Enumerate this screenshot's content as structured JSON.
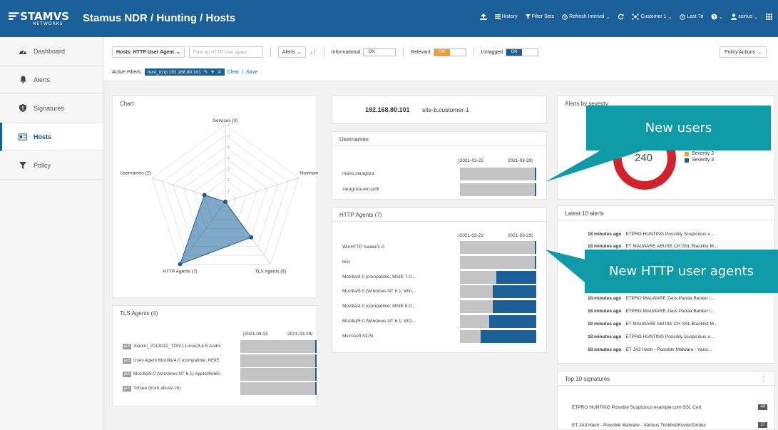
{
  "brand": {
    "logo_main": "STAMVS",
    "logo_sub": "NETWORKS"
  },
  "header": {
    "title": "Stamus NDR / Hunting / Hosts",
    "nav": {
      "history": "History",
      "filter_sets": "Filter Sets",
      "refresh": "Refresh Interval",
      "tenant": "Customer 1",
      "period": "Last 7d",
      "user": "scirius"
    }
  },
  "sidebar": {
    "items": [
      {
        "label": "Dashboard",
        "icon": "dashboard-icon"
      },
      {
        "label": "Alerts",
        "icon": "bell-icon"
      },
      {
        "label": "Signatures",
        "icon": "shield-icon"
      },
      {
        "label": "Hosts",
        "icon": "id-card-icon"
      },
      {
        "label": "Policy",
        "icon": "filter-icon"
      }
    ]
  },
  "filters": {
    "type_select": "Hosts: HTTP User Agent",
    "filter_placeholder": "Filter by HTTP User Agent",
    "sort_select": "Alerts",
    "informational_label": "Informational",
    "informational_on": "ON",
    "relevant_label": "Relevant",
    "relevant_on": "ON",
    "untagged_label": "Untagged",
    "untagged_on": "ON",
    "policy_actions": "Policy Actions",
    "active_filters_label": "Active Filters:",
    "active_chip": "host_id.ip:192.168.80.101",
    "clear": "Clear",
    "save": "Save"
  },
  "chart_panel": {
    "title": "Chart",
    "chart_data": {
      "type": "radar",
      "axes": [
        "Services (0)",
        "Hostnames (",
        "TLS Agents (4)",
        "HTTP Agents (7)",
        "Usernames (2)"
      ],
      "values": [
        0,
        0,
        4,
        7,
        2
      ],
      "ticks": [
        "1",
        "2",
        "3",
        "4",
        "5",
        "6",
        "7"
      ],
      "rmax": 7
    }
  },
  "host": {
    "ip": "192.168.80.101",
    "name": "site-b.customer-1"
  },
  "usernames": {
    "title": "Usernames",
    "date_start": "2021-03-22",
    "date_end": "2021-03-29",
    "rows": [
      {
        "label": "mario.zaragoza",
        "fill": 0.01
      },
      {
        "label": "zaragoza-win-pc$",
        "fill": 0.01
      }
    ]
  },
  "http_agents": {
    "title": "HTTP Agents (7)",
    "date_start": "2021-03-22",
    "date_end": "2021-03-29",
    "rows": [
      {
        "label": "WinHTTP loader/1.0",
        "fill": 0.01
      },
      {
        "label": "test",
        "fill": 0.01
      },
      {
        "label": "Mozilla/4.0 (compatible; MSIE 7.0;...",
        "fill": 0.52
      },
      {
        "label": "Mozilla/5.0 (Windows NT 6.1; Win...",
        "fill": 0.57
      },
      {
        "label": "Mozilla/4.0 (compatible; MSIE 8.0;...",
        "fill": 0.57
      },
      {
        "label": "Mozilla/5.0 (Windows NT 6.1; WO...",
        "fill": 0.62
      },
      {
        "label": "Microsoft NCSI",
        "fill": 0.73
      }
    ]
  },
  "tls_agents": {
    "title": "TLS Agents (4)",
    "date_start": "2021-03-22",
    "date_end": "2021-03-29",
    "rows": [
      {
        "tag": "ja3",
        "label": "Xiaomi_2013022_TD/V1 Linux/3.4.5 Andrc",
        "fill": 0.01
      },
      {
        "tag": "ja3",
        "label": "User-Agent:Mozilla/4.0 (compatible; MSIE",
        "fill": 0.01
      },
      {
        "tag": "ja3",
        "label": "Mozilla/5.0 (Windows NT 6.1) AppleWebKi",
        "fill": 0.01
      },
      {
        "tag": "ja3",
        "label": "Tofsee (from abuse.ch)",
        "fill": 0.01
      }
    ]
  },
  "severity": {
    "title": "Alerts by severity",
    "total": "240",
    "legend": [
      {
        "label": "Severity 2",
        "color": "#f39c28"
      },
      {
        "label": "Severity 3",
        "color": "#1a5f97"
      }
    ]
  },
  "latest_alerts": {
    "title": "Latest 10 alerts",
    "rows": [
      {
        "time": "18 minutes ago",
        "msg": "ETPRO HUNTING Possibly Suspicious e..."
      },
      {
        "time": "18 minutes ago",
        "msg": "ET MALWARE ABUSE.CH SSL Blacklist M..."
      },
      {
        "time": "18 minutes ago",
        "msg": "ETPRO MALWARE Zeus Panda Banker /..."
      },
      {
        "time": "18 minutes ago",
        "msg": "ETPRO MALWARE Zeus Panda Banker /..."
      },
      {
        "time": "18 minutes ago",
        "msg": "ET MALWARE ABUSE.CH SSL Blacklist M..."
      },
      {
        "time": "18 minutes ago",
        "msg": "ETPRO HUNTING Possibly Suspicious e..."
      },
      {
        "time": "18 minutes ago",
        "msg": "ET JA3 Hash - Possible Malware - Vario..."
      }
    ]
  },
  "top_signatures": {
    "title": "Top 10 signatures",
    "rows": [
      {
        "label": "ETPRO HUNTING Possibly Suspicious example.com SSL Cert",
        "count": "44"
      },
      {
        "label": "ET JA3 Hash - Possible Malware - Various Trickbot/Kovter/Dridex",
        "count": "27"
      }
    ]
  },
  "callouts": {
    "users": "New users",
    "agents": "New HTTP user agents"
  }
}
